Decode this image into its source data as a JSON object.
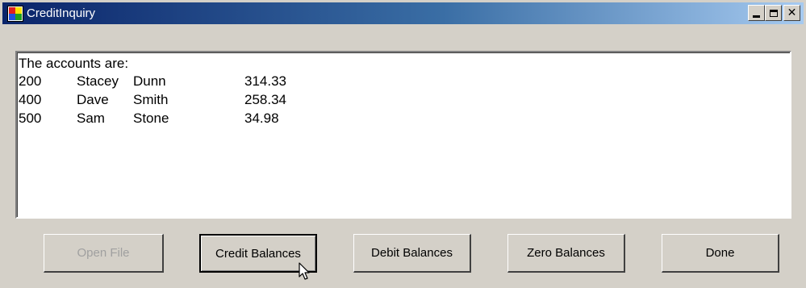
{
  "window": {
    "title": "CreditInquiry",
    "title_bar_colors": {
      "start": "#0a246a",
      "end": "#a6caf0"
    }
  },
  "output": {
    "heading": "The accounts are:",
    "rows": [
      {
        "account": "200",
        "first": "Stacey",
        "last": "Dunn",
        "balance": "314.33"
      },
      {
        "account": "400",
        "first": "Dave",
        "last": "Smith",
        "balance": "258.34"
      },
      {
        "account": "500",
        "first": "Sam",
        "last": "Stone",
        "balance": "34.98"
      }
    ]
  },
  "buttons": {
    "open_file": "Open File",
    "credit_balances": "Credit Balances",
    "debit_balances": "Debit Balances",
    "zero_balances": "Zero Balances",
    "done": "Done"
  },
  "states": {
    "open_file_disabled": true,
    "focused_button": "credit_balances"
  },
  "icons": [
    "app-icon",
    "minimize-icon",
    "maximize-icon",
    "close-icon",
    "mouse-pointer-icon"
  ]
}
